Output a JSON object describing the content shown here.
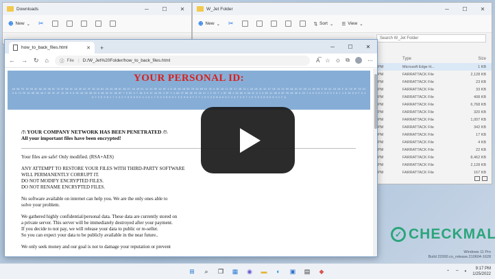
{
  "explorer_downloads": {
    "title": "Downloads",
    "new_label": "New"
  },
  "explorer_wjet": {
    "title": "W_Jet Folder",
    "new_label": "New",
    "sort_label": "Sort",
    "view_label": "View",
    "search_placeholder": "Search W_Jet Folder",
    "columns": [
      "Type",
      "Size"
    ],
    "rows": [
      {
        "date": "PM",
        "type": "Microsoft Edge H...",
        "size": "1 KB",
        "selected": true
      },
      {
        "date": "PM",
        "type": "FARRATTACK File",
        "size": "2,128 KB"
      },
      {
        "date": "PM",
        "type": "FARRATTACK File",
        "size": "23 KB"
      },
      {
        "date": "PM",
        "type": "FARRATTACK File",
        "size": "33 KB"
      },
      {
        "date": "PM",
        "type": "FARRATTACK File",
        "size": "408 KB"
      },
      {
        "date": "PM",
        "type": "FARRATTACK File",
        "size": "6,768 KB"
      },
      {
        "date": "PM",
        "type": "FARRATTACK File",
        "size": "320 KB"
      },
      {
        "date": "PM",
        "type": "FARRATTACK File",
        "size": "1,007 KB"
      },
      {
        "date": "PM",
        "type": "FARRATTACK File",
        "size": "342 KB"
      },
      {
        "date": "PM",
        "type": "FARRATTACK File",
        "size": "17 KB"
      },
      {
        "date": "PM",
        "type": "FARRATTACK File",
        "size": "4 KB"
      },
      {
        "date": "PM",
        "type": "FARRATTACK File",
        "size": "22 KB"
      },
      {
        "date": "PM",
        "type": "FARRATTACK File",
        "size": "8,462 KB"
      },
      {
        "date": "PM",
        "type": "FARRATTACK File",
        "size": "2,128 KB"
      },
      {
        "date": "PM",
        "type": "FARRATTACK File",
        "size": "167 KB"
      }
    ]
  },
  "browser": {
    "tab_title": "how_to_back_files.html",
    "file_label": "File",
    "url": "D:/W_Jet%20Folder/how_to_back_files.html"
  },
  "note": {
    "banner_title": "YOUR PERSONAL ID:",
    "id_hex": "A3 89 F5 78 56 2E 8A 20 3B 9C 79 5F B9 DC 1A 2D 9C 4F 39 19 B1 C0 2A 0B DC 85 E7 18 10 E1 11 4C 0F 12 DF 1 B 2D 08 1B 5D 79 22 08 E1 3C 8 2E 18 C1 5E 17 4B 7A 1 A4 D5 3C 9C E7 DA 7A 34 E0 9A 91 CE 56 11 6D 09 8 02 81 18 28 E 1C 10 0F 35 E2 3 B 74 F0 1D 80 3B 48 F 6F 2C 4F 12 3E 8 8 05 26 58 2B 33 8 3B 4E 5C 0A 8F 7 D E5 3 7 1B 8 8 1F 42 DE 3 EF 2 4 89 CF B9 9E C0 2A 27 1 E C5 F 1 6F 3B 4 62 AE 6 4A 1C 6 4 8 6C 11 4B 8 AF F9 46 3E 9 1D 7 A D 3 8 E 3 0 D 2 8 C 4 6 1E 0 A F 6 4 9 7 2 E 5 B 1 7 C 3 D F 8 A 6 0 E 4 2 9 1 7 5 D 3 B 8 6 C 4 E 0 A 9 F 2 7 1 D 5 3 E B 8 6 0 C 4 A F 2 9 7 1 E 5 D 3 B 6 8 0 4 C F A",
    "heading_line1": "/!\\ YOUR COMPANY NETWORK HAS BEEN PENETRATED /!\\",
    "heading_line2": "All your important files have been encrypted!",
    "p1": "Your files are safe! Only modified. (RSA+AES)",
    "p2_l1": "ANY ATTEMPT TO RESTORE YOUR FILES WITH THIRD-PARTY SOFTWARE",
    "p2_l2": "WILL PERMANENTLY CORRUPT IT.",
    "p2_l3": "DO NOT MODIFY ENCRYPTED FILES.",
    "p2_l4": "DO NOT RENAME ENCRYPTED FILES.",
    "p3_l1": "No software available on internet can help you. We are the only ones able to",
    "p3_l2": "solve your problem.",
    "p4_l1": "We gathered highly confidential/personal data. These data are currently stored on",
    "p4_l2": "a private server. This server will be immediately destroyed after your payment.",
    "p4_l3": "If you decide to not pay, we will release your data to public or re-seller.",
    "p4_l4": "So you can expect your data to be publicly available in the near future..",
    "p5_l1": "We only seek money and our goal is not to damage your reputation or prevent"
  },
  "watermark": {
    "text": "CHECKMAL"
  },
  "os_info": {
    "line1": "Windows 11 Pro",
    "line2": "Build 22000.co_release.210604-1628"
  },
  "taskbar": {
    "time": "9:17 PM",
    "date": "1/25/2022"
  },
  "colors": {
    "banner_bg": "#86add6",
    "banner_title": "#d9201b",
    "watermark": "#2aa57b"
  }
}
